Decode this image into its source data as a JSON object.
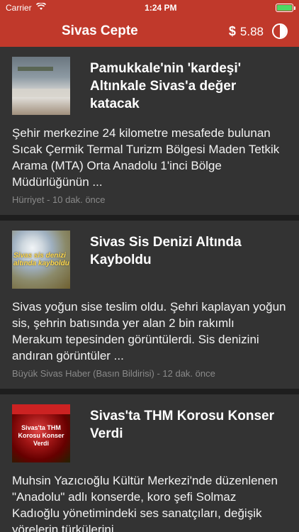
{
  "status": {
    "carrier": "Carrier",
    "time": "1:24 PM"
  },
  "nav": {
    "title": "Sivas Cepte",
    "currency": "$",
    "price": "5.88"
  },
  "articles": [
    {
      "title": "Pamukkale'nin 'kardeşi' Altınkale Sivas'a değer katacak",
      "summary": "Şehir merkezine 24 kilometre mesafede bulunan Sıcak Çermik Termal Turizm Bölgesi Maden Tetkik Arama (MTA) Orta Anadolu 1'inci Bölge Müdürlüğünün ...",
      "source": "Hürriyet - 10 dak. önce"
    },
    {
      "title": "Sivas Sis Denizi Altında Kayboldu",
      "summary": "Sivas yoğun sise teslim oldu. Şehri kaplayan yoğun sis, şehrin batısında yer alan 2 bin rakımlı Merakum tepesinden görüntülerdi. Sis denizini andıran görüntüler ...",
      "source": "Büyük Sivas Haber (Basın Bildirisi) - 12 dak. önce",
      "thumb_caption": "Sivas sis denizi altında kayboldu"
    },
    {
      "title": "Sivas'ta THM Korosu Konser Verdi",
      "summary": "Muhsin Yazıcıoğlu Kültür Merkezi'nde düzenlenen \"Anadolu\" adlı konserde, koro şefi Solmaz Kadıoğlu yönetimindeki ses sanatçıları, değişik yörelerin türkülerini ...",
      "thumb_caption": "Sivas'ta THM Korosu Konser Verdi"
    }
  ]
}
